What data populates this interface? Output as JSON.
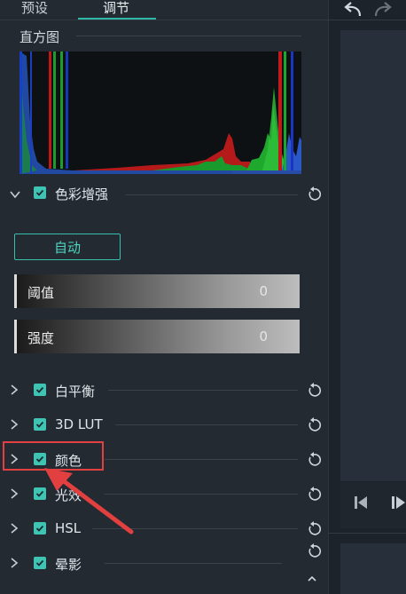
{
  "tabs": [
    {
      "label": "预设"
    },
    {
      "label": "调节"
    }
  ],
  "histogram": {
    "title": "直方图"
  },
  "color_enhance": {
    "label": "色彩增强",
    "auto_label": "自动"
  },
  "sliders": [
    {
      "label": "阈值",
      "value": "0"
    },
    {
      "label": "强度",
      "value": "0"
    }
  ],
  "rows": [
    {
      "label": "白平衡"
    },
    {
      "label": "3D LUT"
    },
    {
      "label": "颜色"
    },
    {
      "label": "光效"
    },
    {
      "label": "HSL"
    },
    {
      "label": "晕影"
    }
  ],
  "colors": {
    "accent": "#3fc4b4",
    "highlight": "#e24040"
  }
}
